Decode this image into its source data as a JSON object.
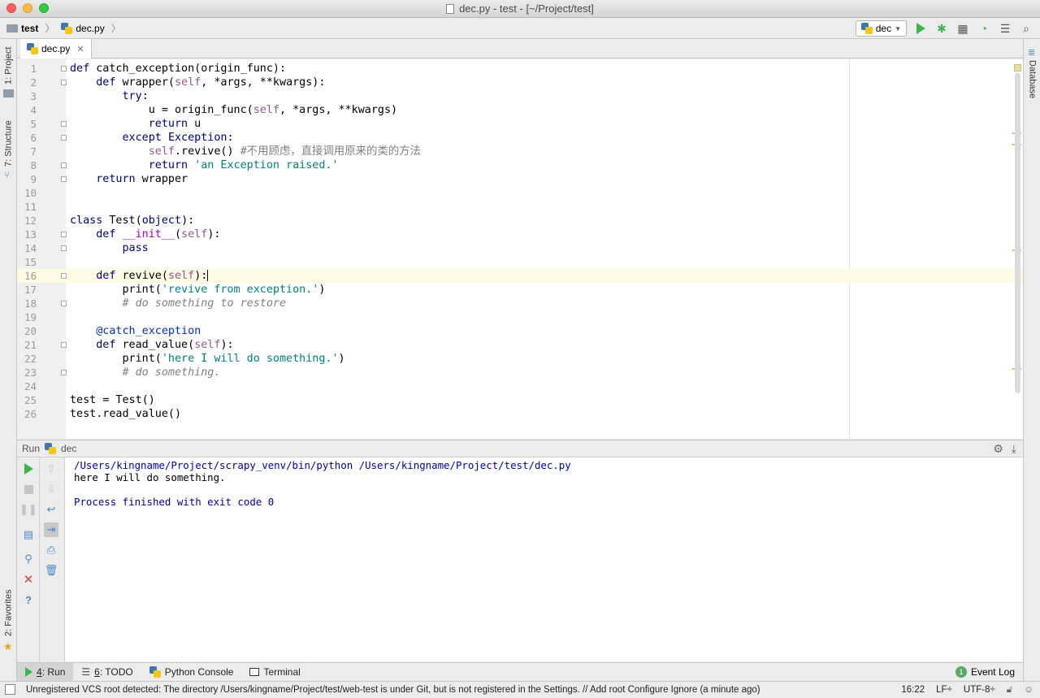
{
  "window": {
    "title": "dec.py - test - [~/Project/test]"
  },
  "navbar": {
    "project": "test",
    "file": "dec.py",
    "run_config": "dec"
  },
  "left_stripe": {
    "project_tab": "1: Project",
    "structure_tab": "7: Structure",
    "favorites_tab": "2: Favorites"
  },
  "right_stripe": {
    "database_tab": "Database"
  },
  "editor": {
    "tab_label": "dec.py",
    "current_line": 16,
    "lines": [
      {
        "n": "1",
        "html": "<span class=\"kw\">def</span> catch_exception(origin_func):"
      },
      {
        "n": "2",
        "html": "    <span class=\"kw\">def</span> wrapper(<span class=\"self\">self</span>, *args, **kwargs):"
      },
      {
        "n": "3",
        "html": "        <span class=\"kw\">try</span>:"
      },
      {
        "n": "4",
        "html": "            u = origin_func(<span class=\"self\">self</span>, *args, **kwargs)"
      },
      {
        "n": "5",
        "html": "            <span class=\"kw\">return</span> u"
      },
      {
        "n": "6",
        "html": "        <span class=\"kw\">except</span> <span class=\"kw\">Exception</span>:"
      },
      {
        "n": "7",
        "html": "            <span class=\"self\">self</span>.revive() <span class=\"cmt-n\">#不用顾虑，直接调用原来的类的方法</span>"
      },
      {
        "n": "8",
        "html": "            <span class=\"kw\">return</span> <span class=\"str\">'an Exception raised.'</span>"
      },
      {
        "n": "9",
        "html": "    <span class=\"kw\">return</span> wrapper"
      },
      {
        "n": "10",
        "html": ""
      },
      {
        "n": "11",
        "html": ""
      },
      {
        "n": "12",
        "html": "<span class=\"kw\">class</span> Test(<span class=\"kw\">object</span>):"
      },
      {
        "n": "13",
        "html": "    <span class=\"kw\">def</span> <span class=\"magic\">__init__</span>(<span class=\"self\">self</span>):"
      },
      {
        "n": "14",
        "html": "        <span class=\"kw\">pass</span>"
      },
      {
        "n": "15",
        "html": ""
      },
      {
        "n": "16",
        "html": "    <span class=\"kw\">def</span> revive(<span class=\"self\">self</span>):<span class=\"caret\"></span>"
      },
      {
        "n": "17",
        "html": "        print(<span class=\"str\">'revive from exception.'</span>)"
      },
      {
        "n": "18",
        "html": "        <span class=\"cmt\"># do something to restore</span>"
      },
      {
        "n": "19",
        "html": ""
      },
      {
        "n": "20",
        "html": "    <span class=\"dec\">@catch_exception</span>"
      },
      {
        "n": "21",
        "html": "    <span class=\"kw\">def</span> read_value(<span class=\"self\">self</span>):"
      },
      {
        "n": "22",
        "html": "        print(<span class=\"str\">'here I will do something.'</span>)"
      },
      {
        "n": "23",
        "html": "        <span class=\"cmt\"># do something.</span>"
      },
      {
        "n": "24",
        "html": ""
      },
      {
        "n": "25",
        "html": "test = Test()"
      },
      {
        "n": "26",
        "html": "test.read_value()"
      }
    ]
  },
  "run_panel": {
    "label": "Run",
    "config": "dec",
    "output": [
      {
        "text": "/Users/kingname/Project/scrapy_venv/bin/python /Users/kingname/Project/test/dec.py",
        "color": "blue"
      },
      {
        "text": "here I will do something.",
        "color": "black"
      },
      {
        "text": "",
        "color": "black"
      },
      {
        "text": "Process finished with exit code 0",
        "color": "blue"
      }
    ]
  },
  "bottom_tabs": {
    "run_num": "4",
    "run_label": ": Run",
    "todo_num": "6",
    "todo_label": ": TODO",
    "python_console": "Python Console",
    "terminal": "Terminal",
    "event_log": "Event Log",
    "event_count": "1"
  },
  "status": {
    "message": "Unregistered VCS root detected: The directory /Users/kingname/Project/test/web-test is under Git, but is not registered in the Settings. // Add root  Configure  Ignore (a minute ago)",
    "position": "16:22",
    "line_sep": "LF÷",
    "encoding": "UTF-8÷"
  }
}
